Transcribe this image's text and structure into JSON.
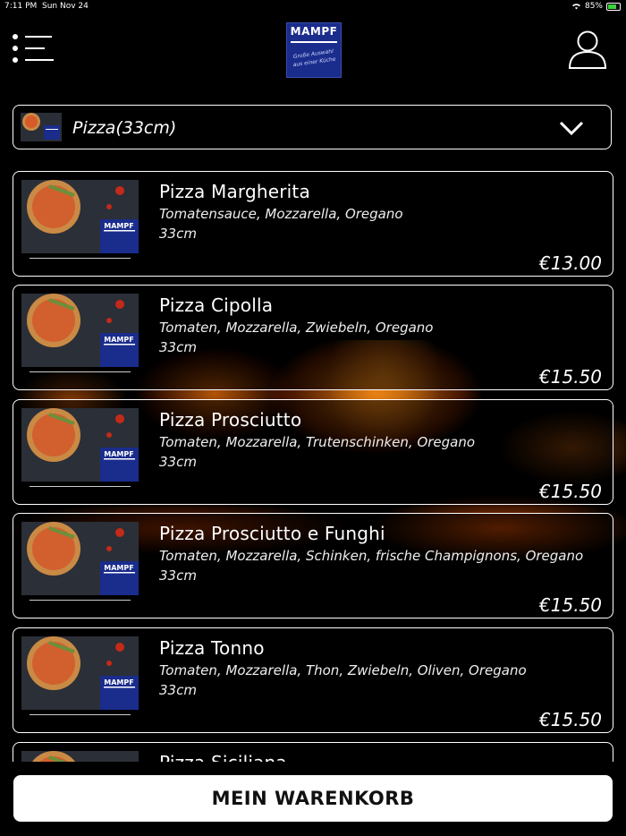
{
  "status_bar": {
    "time": "7:11 PM",
    "date": "Sun Nov 24",
    "battery": "85%"
  },
  "header": {
    "logo_brand": "MAMPF",
    "logo_tagline": "Große Auswahl aus einer Küche"
  },
  "category_selector": {
    "selected": "Pizza(33cm)"
  },
  "products": [
    {
      "title": "Pizza Margherita",
      "description": "Tomatensauce, Mozzarella, Oregano",
      "size": "33cm",
      "price": "€13.00"
    },
    {
      "title": "Pizza Cipolla",
      "description": "Tomaten, Mozzarella, Zwiebeln, Oregano",
      "size": "33cm",
      "price": "€15.50"
    },
    {
      "title": "Pizza Prosciutto",
      "description": "Tomaten, Mozzarella, Trutenschinken, Oregano",
      "size": "33cm",
      "price": "€15.50"
    },
    {
      "title": "Pizza Prosciutto e Funghi",
      "description": "Tomaten, Mozzarella, Schinken, frische Champignons, Oregano",
      "size": "33cm",
      "price": "€15.50"
    },
    {
      "title": "Pizza Tonno",
      "description": "Tomaten, Mozzarella, Thon, Zwiebeln, Oliven, Oregano",
      "size": "33cm",
      "price": "€15.50"
    },
    {
      "title": "Pizza Siciliana",
      "description": "",
      "size": "",
      "price": ""
    }
  ],
  "cart_button": {
    "label": "MEIN WARENKORB"
  }
}
